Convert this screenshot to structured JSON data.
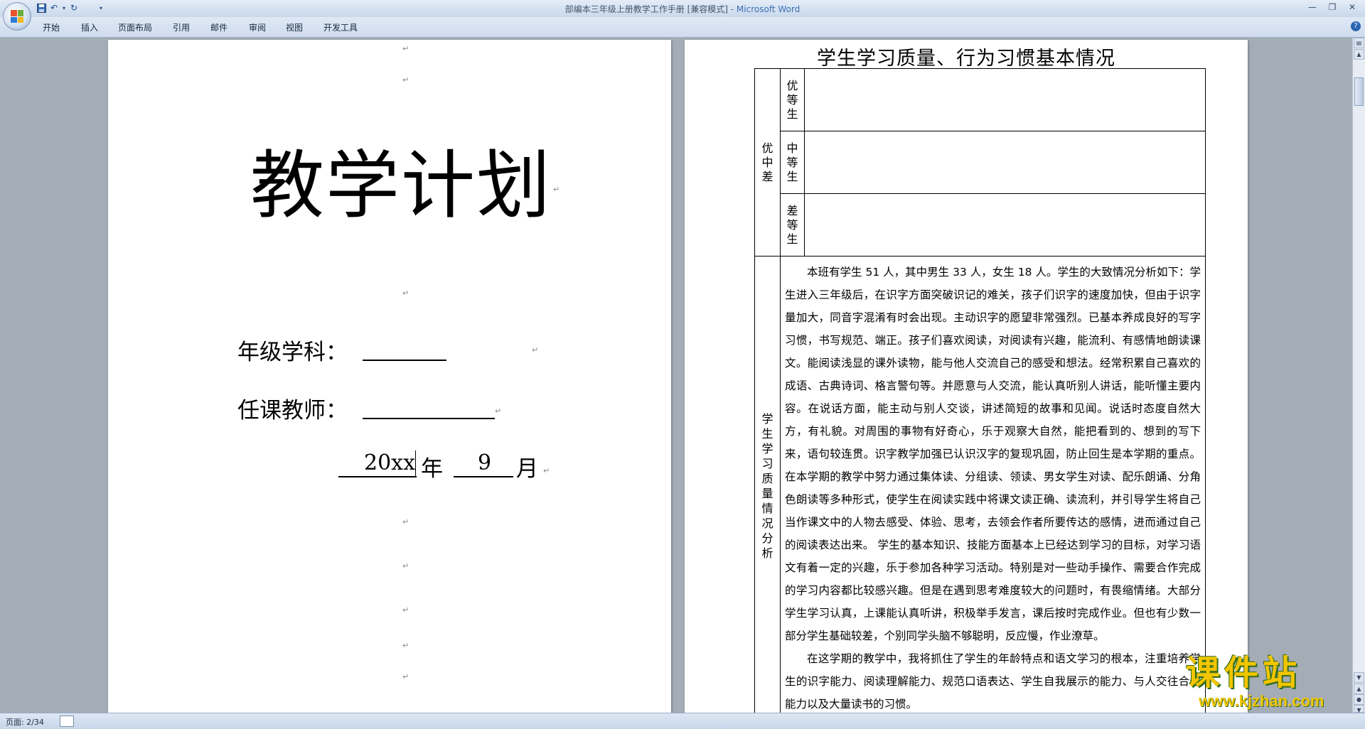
{
  "window": {
    "title": "部编本三年级上册教学工作手册 [兼容模式]",
    "app_suffix": " - Microsoft Word",
    "minimize": "—",
    "restore": "❐",
    "close": "✕"
  },
  "ribbon": {
    "tabs": [
      "开始",
      "插入",
      "页面布局",
      "引用",
      "邮件",
      "审阅",
      "视图",
      "开发工具"
    ],
    "help": "?"
  },
  "qat": {
    "save_icon": "💾",
    "undo_icon": "↶",
    "redo_icon": "↻",
    "customize_icon": "▾"
  },
  "page1": {
    "title": "教学计划",
    "grade_subject_label": "年级学科：",
    "teacher_label": "任课教师：",
    "year_value": "20xx",
    "year_unit": "年",
    "month_value": "9",
    "month_unit": "月",
    "para_mark": "↵"
  },
  "page2": {
    "heading": "学生学习质量、行为习惯基本情况",
    "group_label": [
      "优",
      "中",
      "差"
    ],
    "levels": [
      {
        "chars": [
          "优",
          "等",
          "生"
        ]
      },
      {
        "chars": [
          "中",
          "等",
          "生"
        ]
      },
      {
        "chars": [
          "差",
          "等",
          "生"
        ]
      }
    ],
    "analysis_label": [
      "学",
      "生",
      "学",
      "习",
      "质",
      "量",
      "情",
      "况",
      "分",
      "析"
    ],
    "analysis_paragraph": "本班有学生 51 人，其中男生 33 人，女生 18 人。学生的大致情况分析如下：学生进入三年级后，在识字方面突破识记的难关，孩子们识字的速度加快，但由于识字量加大，同音字混淆有时会出现。主动识字的愿望非常强烈。已基本养成良好的写字习惯，书写规范、端正。孩子们喜欢阅读，对阅读有兴趣，能流利、有感情地朗读课文。能阅读浅显的课外读物，能与他人交流自己的感受和想法。经常积累自己喜欢的成语、古典诗词、格言警句等。并愿意与人交流，能认真听别人讲话，能听懂主要内容。在说话方面，能主动与别人交谈，讲述简短的故事和见闻。说话时态度自然大方，有礼貌。对周围的事物有好奇心，乐于观察大自然，能把看到的、想到的写下来，语句较连贯。识字教学加强已认识汉字的复现巩固，防止回生是本学期的重点。在本学期的教学中努力通过集体读、分组读、领读、男女学生对读、配乐朗诵、分角色朗读等多种形式，使学生在阅读实践中将课文读正确、读流利，并引导学生将自己当作课文中的人物去感受、体验、思考，去领会作者所要传达的感情，进而通过自己的阅读表达出来。 学生的基本知识、技能方面基本上已经达到学习的目标，对学习语文有着一定的兴趣，乐于参加各种学习活动。特别是对一些动手操作、需要合作完成的学习内容都比较感兴趣。但是在遇到思考难度较大的问题时，有畏缩情绪。大部分学生学习认真，上课能认真听讲，积极举手发言，课后按时完成作业。但也有少数一部分学生基础较差，个别同学头脑不够聪明，反应慢，作业潦草。",
    "plan_paragraph": "在这学期的教学中，我将抓住了学生的年龄特点和语文学习的根本，注重培养学生的识字能力、阅读理解能力、规范口语表达、学生自我展示的能力、与人交往合作能力以及大量读书的习惯。"
  },
  "status": {
    "page": "页面: 2/34"
  },
  "watermark": {
    "name": "课件站",
    "url": "www.kjzhan.com"
  }
}
